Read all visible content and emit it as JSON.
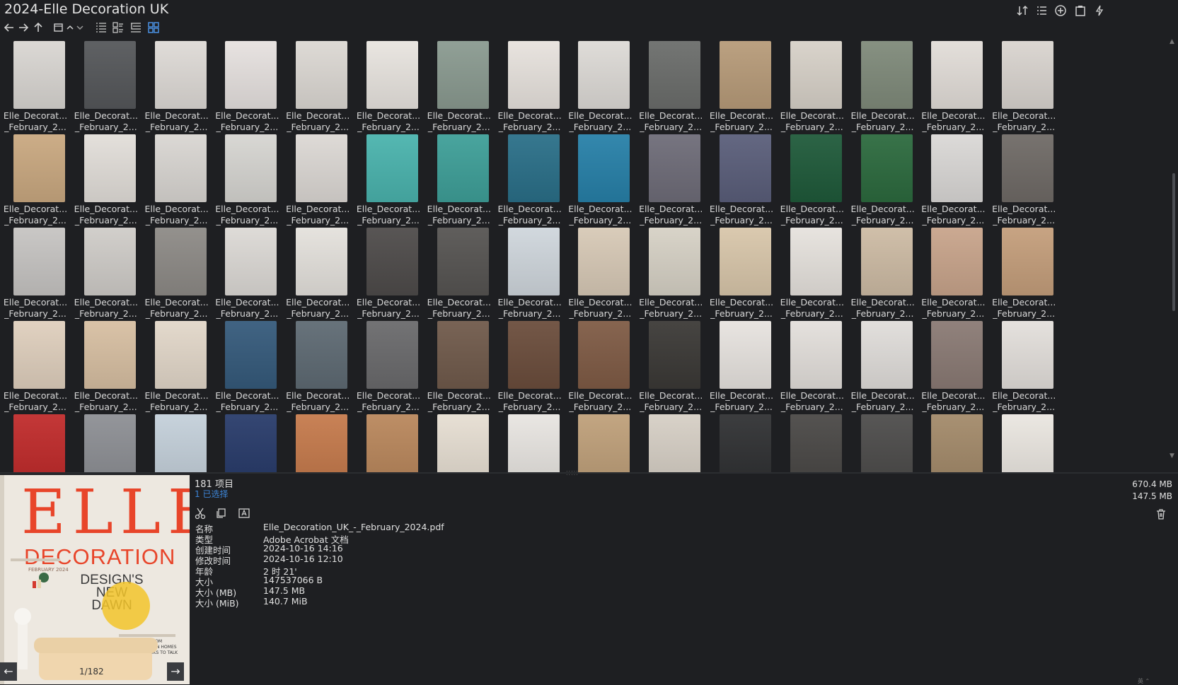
{
  "window": {
    "title": "2024-Elle Decoration UK"
  },
  "toolbar": {
    "right_icons": [
      "sort-icon",
      "list-view-icon",
      "add-circle-icon",
      "clipboard-icon",
      "lightning-icon"
    ],
    "nav_icons": [
      "back-arrow-icon",
      "forward-arrow-icon",
      "up-arrow-icon",
      "folder-icon",
      "chevron-up-icon",
      "chevron-down-icon",
      "details-view-icon",
      "tiles-view-icon",
      "tree-view-icon",
      "thumbnail-view-icon"
    ]
  },
  "grid": {
    "caption_line1": "Elle_Decorat...",
    "caption_line2": "_February_2...",
    "columns": 15,
    "full_rows": 4,
    "partial_row_items": 15,
    "colors": [
      "#d9d6d2",
      "#55575a",
      "#dedad6",
      "#e6e1df",
      "#dcd8d3",
      "#e8e4df",
      "#8a9a90",
      "#e7e2dd",
      "#dddad6",
      "#6b6d6b",
      "#b79b79",
      "#d7d1c8",
      "#7f8a7a",
      "#e2ddd8",
      "#d9d4cf",
      "#c9a880",
      "#e2ded9",
      "#d9d6d2",
      "#d6d5d1",
      "#dcd8d4",
      "#4ab3ad",
      "#3e9f98",
      "#2a6f88",
      "#2780a8",
      "#6e6c78",
      "#5a5e7a",
      "#1f5a3a",
      "#2c6a3e",
      "#dad8d6",
      "#6f6a66",
      "#c6c4c2",
      "#cfccc8",
      "#8d8a86",
      "#dcd9d5",
      "#e4e1dc",
      "#4e4b4a",
      "#565452",
      "#cfd6dc",
      "#d7c9b6",
      "#d6d1c5",
      "#d8c6aa",
      "#e6e2dd",
      "#cdbba4",
      "#c8a48b",
      "#c49e7b",
      "#dfcfbd",
      "#d7bfa2",
      "#e2d7c9",
      "#355a7b",
      "#5e6a73",
      "#6a6a6c",
      "#705a4b",
      "#6b4d3c",
      "#7f5b45",
      "#3b3936",
      "#e7e3df",
      "#e3dfdb",
      "#e0ddda",
      "#8a7a74",
      "#e3dfdb",
      "#c02b2b",
      "#8d8f94",
      "#c4d0da",
      "#283b6a",
      "#c57a4c",
      "#b9875c",
      "#e6ded2",
      "#e8e5e1",
      "#bfa07a",
      "#d6cfc5",
      "#303133",
      "#4a4846",
      "#4d4c4b",
      "#a38a6a",
      "#eae6e0"
    ]
  },
  "preview": {
    "cover_logo": "ELLE",
    "cover_sub": "DECORATION",
    "cover_date": "FEBRUARY 2024",
    "cover_head": "DESIGN'S NEW DAWN",
    "cover_blurb": "LIVING-ROOM LUXURIES IN HOMES AND BOOKS TO TALK ABOUT",
    "page_indicator": "1/182",
    "prev_icon": "prev-arrow-icon",
    "next_icon": "next-arrow-icon"
  },
  "info": {
    "count": "181 项目",
    "selected": "1 已选择",
    "actions": [
      "cut-icon",
      "copy-icon",
      "rename-icon"
    ],
    "props": [
      {
        "label": "名称",
        "value": "Elle_Decoration_UK_-_February_2024.pdf"
      },
      {
        "label": "类型",
        "value": "Adobe Acrobat 文档"
      },
      {
        "label": "创建时间",
        "value": "2024-10-16  14:16"
      },
      {
        "label": "修改时间",
        "value": "2024-10-16  12:10"
      },
      {
        "label": "年龄",
        "value": "2 时 21'"
      },
      {
        "label": "大小",
        "value": "147537066 B"
      },
      {
        "label": "大小 (MB)",
        "value": "147.5 MB"
      },
      {
        "label": "大小 (MiB)",
        "value": "140.7 MiB"
      }
    ],
    "total_size": "670.4 MB",
    "selected_size": "147.5 MB"
  },
  "status": {
    "right": "英 ⌃"
  }
}
